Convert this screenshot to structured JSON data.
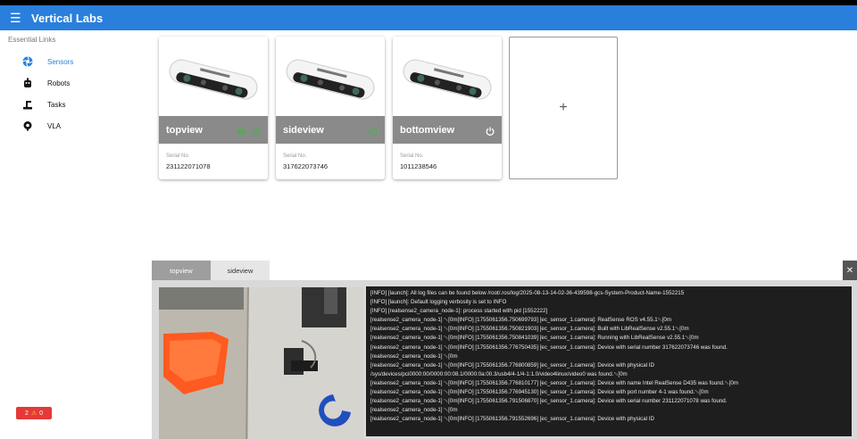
{
  "header": {
    "title": "Vertical Labs",
    "menu_icon": "menu-icon"
  },
  "sidebar": {
    "heading": "Essential Links",
    "items": [
      {
        "label": "Sensors",
        "icon": "aperture-icon",
        "active": true
      },
      {
        "label": "Robots",
        "icon": "robot-icon",
        "active": false
      },
      {
        "label": "Tasks",
        "icon": "robot-arm-icon",
        "active": false
      },
      {
        "label": "VLA",
        "icon": "brain-icon",
        "active": false
      }
    ]
  },
  "status_badge": {
    "errors": "2",
    "warnings": "0"
  },
  "cameras": [
    {
      "name": "topview",
      "serial_label": "Serial No.",
      "serial": "231122071078"
    },
    {
      "name": "sideview",
      "serial_label": "Serial No.",
      "serial": "317622073746"
    },
    {
      "name": "bottomview",
      "serial_label": "Serial No.",
      "serial": "1011238546"
    }
  ],
  "add_card": {
    "label": "+"
  },
  "tabs": [
    {
      "label": "topview"
    },
    {
      "label": "sideview"
    }
  ],
  "close_label": "✕",
  "log_text": "[INFO] [launch]: All log files can be found below /root/.ros/log/2025-08-13-14-02-36-439598-gcs-System-Product-Name-1552215\n[INFO] [launch]: Default logging verbosity is set to INFO\n[INFO] [realsense2_camera_node-1]: process started with pid [1552222]\n[realsense2_camera_node-1] ␛[0m[INFO] [1755061356.750699793] [ec_sensor_1.camera]: RealSense ROS v4.55.1␛[0m\n[realsense2_camera_node-1] ␛[0m[INFO] [1755061356.750821903] [ec_sensor_1.camera]: Built with LibRealSense v2.55.1␛[0m\n[realsense2_camera_node-1] ␛[0m[INFO] [1755061356.750841039] [ec_sensor_1.camera]: Running with LibRealSense v2.55.1␛[0m\n[realsense2_camera_node-1] ␛[0m[INFO] [1755061356.776750435] [ec_sensor_1.camera]: Device with serial number 317622073746 was found.\n[realsense2_camera_node-1] ␛[0m\n[realsense2_camera_node-1] ␛[0m[INFO] [1755061356.776800859] [ec_sensor_1.camera]: Device with physical ID\n/sys/devices/pci0000:00/0000:00:08.1/0000:0a:00.3/usb4/4-1/4-1:1.0/video4linux/video0 was found.␛[0m\n[realsense2_camera_node-1] ␛[0m[INFO] [1755061356.776810177] [ec_sensor_1.camera]: Device with name Intel RealSense D435 was found.␛[0m\n[realsense2_camera_node-1] ␛[0m[INFO] [1755061356.776945130] [ec_sensor_1.camera]: Device with port number 4-1 was found.␛[0m\n[realsense2_camera_node-1] ␛[0m[INFO] [1755061356.791506870] [ec_sensor_1.camera]: Device with serial number 231122071078 was found.\n[realsense2_camera_node-1] ␛[0m\n[realsense2_camera_node-1] ␛[0m[INFO] [1755061356.791552696] [ec_sensor_1.camera]: Device with physical ID",
  "colors": {
    "primary": "#2a7fdc",
    "live_green": "#4caf50",
    "badge_red": "#e53935"
  }
}
